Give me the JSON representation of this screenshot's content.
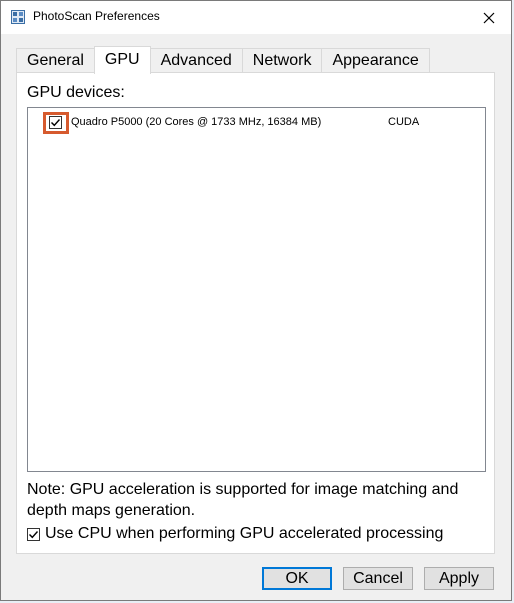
{
  "window": {
    "title": "PhotoScan Preferences"
  },
  "tabs": [
    {
      "label": "General",
      "active": false
    },
    {
      "label": "GPU",
      "active": true
    },
    {
      "label": "Advanced",
      "active": false
    },
    {
      "label": "Network",
      "active": false
    },
    {
      "label": "Appearance",
      "active": false
    }
  ],
  "gpu_panel": {
    "devices_label": "GPU devices:",
    "devices": [
      {
        "name": "Quadro P5000 (20 Cores @ 1733 MHz, 16384 MB)",
        "type": "CUDA",
        "checked": true
      }
    ],
    "note": "Note: GPU acceleration is supported for image matching and depth maps generation.",
    "use_cpu": {
      "label": "Use CPU when performing GPU accelerated processing",
      "checked": true
    }
  },
  "buttons": {
    "ok": "OK",
    "cancel": "Cancel",
    "apply": "Apply"
  },
  "colors": {
    "highlight": "#d65a2e",
    "default_button_border": "#0078d7"
  },
  "icons": {
    "app": "photoscan-app-icon",
    "close": "close-icon",
    "check": "checkmark-icon"
  }
}
